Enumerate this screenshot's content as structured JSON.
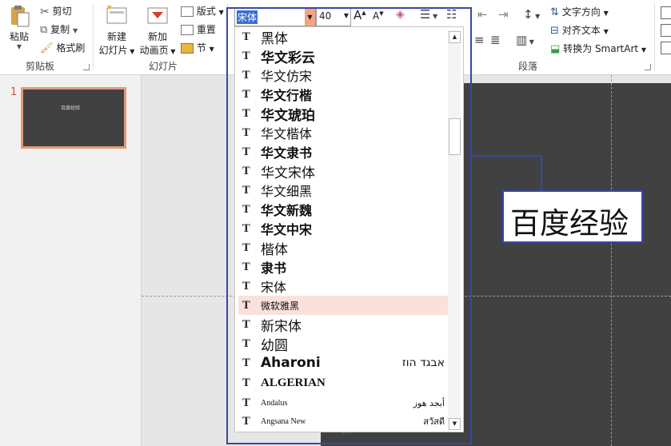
{
  "clipboard": {
    "paste_label": "粘贴",
    "cut_label": "剪切",
    "copy_label": "复制",
    "format_painter_label": "格式刷",
    "group_label": "剪贴板"
  },
  "slides_group": {
    "new_slide_label_1": "新建",
    "new_slide_label_2": "幻灯片",
    "new_anim_label_1": "新加",
    "new_anim_label_2": "动画页",
    "layout_label": "版式",
    "reset_label": "重置",
    "section_label": "节",
    "group_label": "幻灯片"
  },
  "font": {
    "name_value": "宋体",
    "size_value": "40"
  },
  "paragraph": {
    "text_direction_label": "文字方向",
    "align_text_label": "对齐文本",
    "smartart_label": "转换为 SmartArt",
    "group_label": "段落"
  },
  "thumbnail": {
    "number": "1",
    "caption": "百度经验"
  },
  "slide": {
    "textbox_text": "百度经验",
    "background_color": "#424142",
    "selection_color": "#3548a8"
  },
  "font_list": {
    "items": [
      {
        "name": "黑体",
        "sample": ""
      },
      {
        "name": "华文彩云",
        "sample": ""
      },
      {
        "name": "华文仿宋",
        "sample": ""
      },
      {
        "name": "华文行楷",
        "sample": ""
      },
      {
        "name": "华文琥珀",
        "sample": ""
      },
      {
        "name": "华文楷体",
        "sample": ""
      },
      {
        "name": "华文隶书",
        "sample": ""
      },
      {
        "name": "华文宋体",
        "sample": ""
      },
      {
        "name": "华文细黑",
        "sample": ""
      },
      {
        "name": "华文新魏",
        "sample": ""
      },
      {
        "name": "华文中宋",
        "sample": ""
      },
      {
        "name": "楷体",
        "sample": ""
      },
      {
        "name": "隶书",
        "sample": ""
      },
      {
        "name": "宋体",
        "sample": ""
      },
      {
        "name": "微软雅黑",
        "sample": ""
      },
      {
        "name": "新宋体",
        "sample": ""
      },
      {
        "name": "幼圆",
        "sample": ""
      },
      {
        "name": "Aharoni",
        "sample": "אבגד הוז"
      },
      {
        "name": "ALGERIAN",
        "sample": ""
      },
      {
        "name": "Andalus",
        "sample": "أبجد هوز"
      },
      {
        "name": "Angsana New",
        "sample": "สวัสดี"
      }
    ],
    "selected_index": 14,
    "highlight_color": "#fbe1db"
  }
}
